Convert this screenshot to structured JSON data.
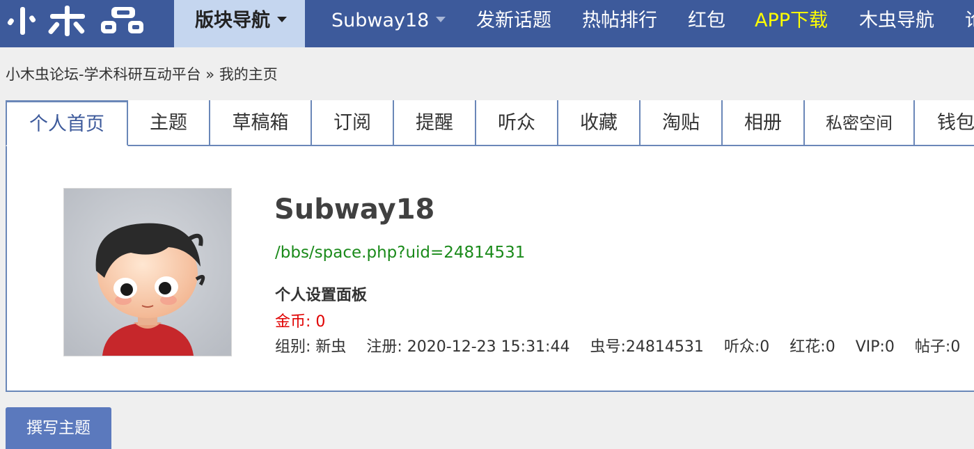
{
  "logo": {
    "text": "小木虫",
    "icon": "xiaomuchong-logo"
  },
  "topnav": {
    "items": [
      {
        "label": "版块导航",
        "active": true,
        "caret": true
      },
      {
        "label": "Subway18",
        "caret": true
      },
      {
        "label": "发新话题"
      },
      {
        "label": "热帖排行"
      },
      {
        "label": "红包"
      },
      {
        "label": "APP下载",
        "highlight": true
      },
      {
        "label": "木虫导航"
      },
      {
        "label": "论"
      }
    ]
  },
  "breadcrumb": {
    "home": "小木虫论坛-学术科研互动平台",
    "separator": "»",
    "current": "我的主页"
  },
  "tabs": [
    {
      "label": "个人首页",
      "active": true
    },
    {
      "label": "主题"
    },
    {
      "label": "草稿箱"
    },
    {
      "label": "订阅"
    },
    {
      "label": "提醒"
    },
    {
      "label": "听众"
    },
    {
      "label": "收藏"
    },
    {
      "label": "淘贴"
    },
    {
      "label": "相册"
    },
    {
      "label": "私密空间"
    },
    {
      "label": "钱包"
    }
  ],
  "profile": {
    "username": "Subway18",
    "space_url": "/bbs/space.php?uid=24814531",
    "settings_title": "个人设置面板",
    "coins": "金币: 0",
    "stats": {
      "group": "组别: 新虫",
      "registered": "注册: 2020-12-23 15:31:44",
      "uid": "虫号:24814531",
      "listeners": "听众:0",
      "flowers": "红花:0",
      "vip": "VIP:0",
      "posts": "帖子:0"
    }
  },
  "actions": {
    "write_topic": "撰写主题"
  },
  "colors": {
    "nav_bg": "#3d5a9b",
    "nav_active_bg": "#c5d6ef",
    "highlight": "#ffff00",
    "link_green": "#1a8a1a",
    "coin_red": "#e00000",
    "button_bg": "#5b79bd"
  }
}
